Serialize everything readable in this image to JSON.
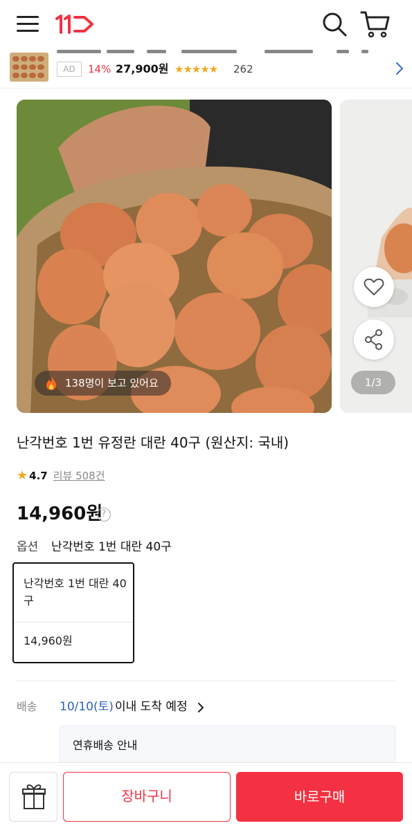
{
  "header": {
    "menu_icon": "hamburger-menu-icon",
    "logo": "11번가 logo",
    "search_icon": "search-icon",
    "cart_icon": "cart-icon",
    "brand_color": "#f43142"
  },
  "ad": {
    "badge": "AD",
    "discount": "14%",
    "price": "27,900원",
    "stars": "★★★★★",
    "rating_value": 4.5,
    "review_count": "262",
    "chevron_icon": "chevron-right-icon"
  },
  "gallery": {
    "watching_text": "138명이 보고 있어요",
    "fire_icon": "fire-icon",
    "like_icon": "heart-icon",
    "share_icon": "share-icon",
    "pager": "1/3"
  },
  "product": {
    "title": "난각번호 1번 유정란 대란 40구 (원산지: 국내)",
    "rating_star": "★",
    "rating": "4.7",
    "reviews": "리뷰 508건",
    "price": "14,960원",
    "price_info": "?",
    "option_label": "옵션",
    "option_value": "난각번호 1번 대란 40구",
    "option_card": {
      "name": "난각번호 1번 대란 40구",
      "price": "14,960원"
    }
  },
  "shipping": {
    "label": "배송",
    "date": "10/10(토)",
    "text": "이내 도착 예정",
    "notice": "연휴배송 안내"
  },
  "bottom": {
    "gift_icon": "gift-icon",
    "cart_label": "장바구니",
    "buy_label": "바로구매"
  }
}
